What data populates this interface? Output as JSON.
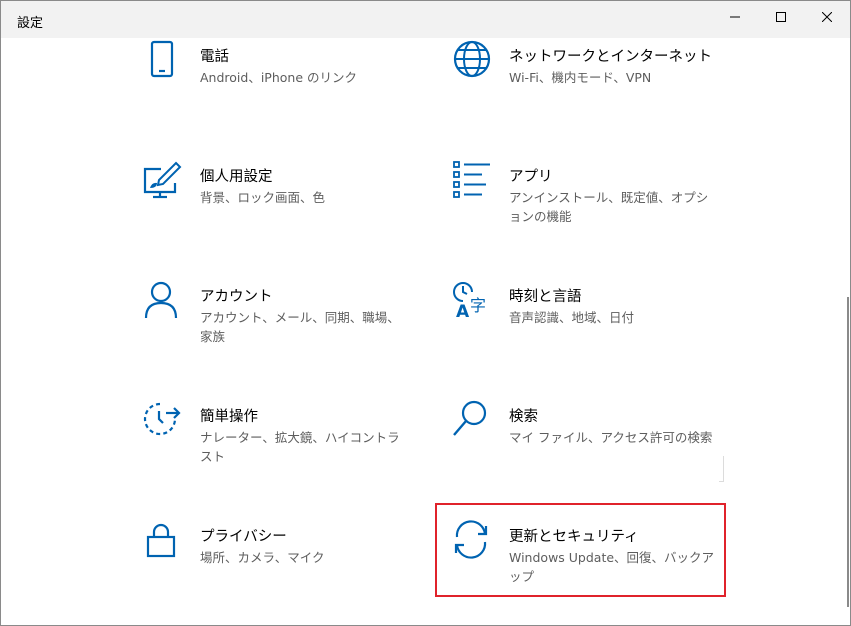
{
  "window": {
    "title": "設定",
    "controls": {
      "minimize": "minimize-icon",
      "maximize": "maximize-icon",
      "close": "close-icon"
    }
  },
  "accent_color": "#0063b1",
  "highlight_color": "#e0232b",
  "tiles": [
    {
      "id": "phone",
      "name": "電話",
      "desc": "Android、iPhone のリンク",
      "icon": "phone-icon"
    },
    {
      "id": "network",
      "name": "ネットワークとインターネット",
      "desc": "Wi-Fi、機内モード、VPN",
      "icon": "globe-icon"
    },
    {
      "id": "personalization",
      "name": "個人用設定",
      "desc": "背景、ロック画面、色",
      "icon": "paint-monitor-icon"
    },
    {
      "id": "apps",
      "name": "アプリ",
      "desc": "アンインストール、既定値、オプションの機能",
      "icon": "apps-list-icon"
    },
    {
      "id": "accounts",
      "name": "アカウント",
      "desc": "アカウント、メール、同期、職場、家族",
      "icon": "person-icon"
    },
    {
      "id": "time-language",
      "name": "時刻と言語",
      "desc": "音声認識、地域、日付",
      "icon": "time-language-icon"
    },
    {
      "id": "ease-of-access",
      "name": "簡単操作",
      "desc": "ナレーター、拡大鏡、ハイコントラスト",
      "icon": "ease-of-access-icon"
    },
    {
      "id": "search",
      "name": "検索",
      "desc": "マイ ファイル、アクセス許可の検索",
      "icon": "search-icon"
    },
    {
      "id": "privacy",
      "name": "プライバシー",
      "desc": "場所、カメラ、マイク",
      "icon": "lock-icon"
    },
    {
      "id": "update-security",
      "name": "更新とセキュリティ",
      "desc": "Windows Update、回復、バックアップ",
      "icon": "sync-icon"
    }
  ]
}
